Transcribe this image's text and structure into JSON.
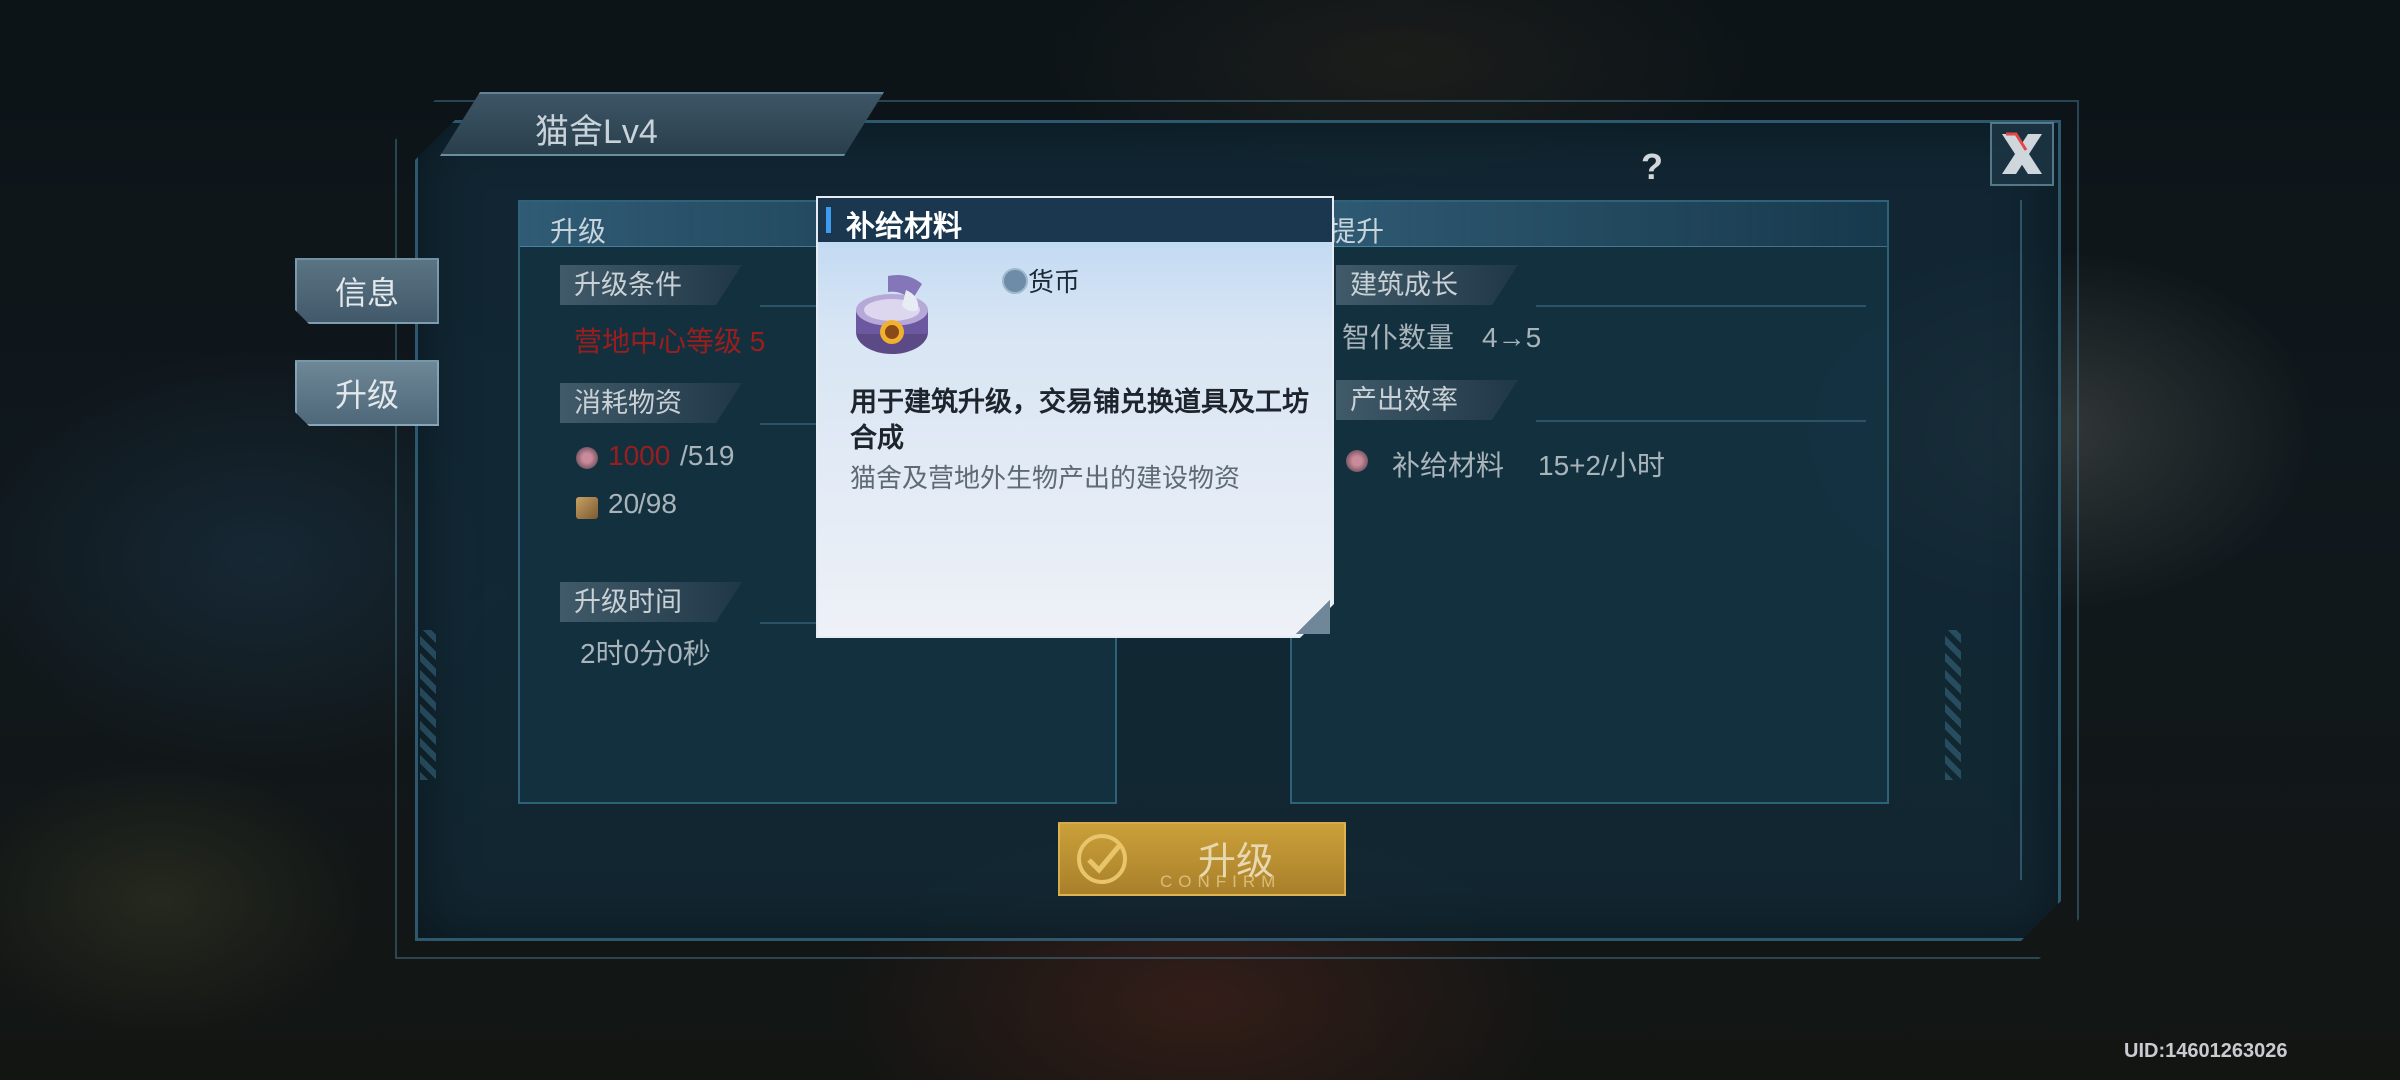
{
  "window": {
    "title": "猫舍Lv4",
    "close_icon": "close-x-icon",
    "help_label": "?"
  },
  "side_tabs": [
    {
      "label": "信息",
      "active": false
    },
    {
      "label": "升级",
      "active": true
    }
  ],
  "left_panel": {
    "header": "升级",
    "conditions_title": "升级条件",
    "conditions_value": "营地中心等级 5",
    "consume_title": "消耗物资",
    "materials": [
      {
        "icon": "supply-can-icon",
        "have": "1000",
        "need": "/519",
        "have_color": "#9b1e1e"
      },
      {
        "icon": "wood-crate-icon",
        "have": "20",
        "need": "/98"
      }
    ],
    "time_title": "升级时间",
    "time_value": "2时0分0秒"
  },
  "right_panel": {
    "header": "提升",
    "growth_title": "建筑成长",
    "growth_value": "智仆数量　4→5",
    "output_title": "产出效率",
    "output_item": "补给材料",
    "output_value": "15+2/小时"
  },
  "confirm_button": {
    "label": "升级",
    "sub_label": "CONFIRM",
    "color": "#caa03a"
  },
  "tooltip": {
    "title": "补给材料",
    "type": "货币",
    "description": "用于建筑升级，交易铺兑换道具及工坊合成",
    "source": "猫舍及营地外生物产出的建设物资",
    "accent_color": "#3d9cf0"
  },
  "uid": "UID:14601263026"
}
